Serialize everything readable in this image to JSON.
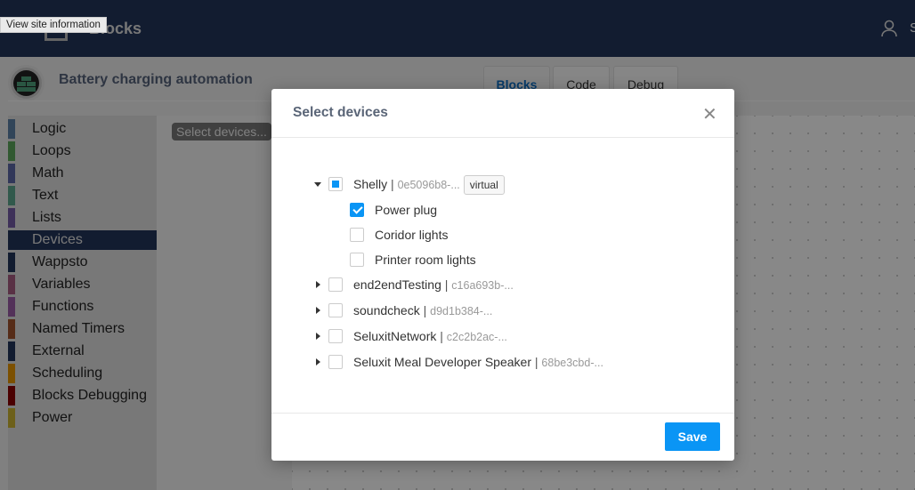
{
  "tooltip": "View site information",
  "header": {
    "app_name": "Blocks",
    "user_initial": "S"
  },
  "project": {
    "title": "Battery charging automation"
  },
  "tabs": [
    {
      "label": "Blocks",
      "active": true
    },
    {
      "label": "Code"
    },
    {
      "label": "Debug"
    }
  ],
  "sidebar": {
    "items": [
      {
        "label": "Logic",
        "color": "#5b80a5"
      },
      {
        "label": "Loops",
        "color": "#5ba55b"
      },
      {
        "label": "Math",
        "color": "#5b67a5"
      },
      {
        "label": "Text",
        "color": "#5ba58c"
      },
      {
        "label": "Lists",
        "color": "#745ba5"
      },
      {
        "label": "Devices",
        "color": "#22345a",
        "selected": true
      },
      {
        "label": "Wappsto",
        "color": "#22345a"
      },
      {
        "label": "Variables",
        "color": "#a55b80"
      },
      {
        "label": "Functions",
        "color": "#995ba5"
      },
      {
        "label": "Named Timers",
        "color": "#a0522d"
      },
      {
        "label": "External",
        "color": "#22345a"
      },
      {
        "label": "Scheduling",
        "color": "#e69500"
      },
      {
        "label": "Blocks Debugging",
        "color": "#8b0000"
      },
      {
        "label": "Power",
        "color": "#c9b230"
      }
    ]
  },
  "flyout": {
    "label": "Select devices..."
  },
  "modal": {
    "title": "Select devices",
    "close_icon": "close-x",
    "save_label": "Save",
    "accent": "#0a95f5",
    "tree": {
      "shelly": {
        "name": "Shelly",
        "id": "0e5096b8-...",
        "badge": "virtual",
        "state": "partial",
        "expanded": true,
        "children": [
          {
            "name": "Power plug",
            "checked": true
          },
          {
            "name": "Coridor lights",
            "checked": false
          },
          {
            "name": "Printer room lights",
            "checked": false
          }
        ]
      },
      "others": [
        {
          "name": "end2endTesting",
          "id": "c16a693b-..."
        },
        {
          "name": "soundcheck",
          "id": "d9d1b384-..."
        },
        {
          "name": "SeluxitNetwork",
          "id": "c2c2b2ac-..."
        },
        {
          "name": "Seluxit Meal Developer Speaker",
          "id": "68be3cbd-..."
        }
      ]
    }
  }
}
